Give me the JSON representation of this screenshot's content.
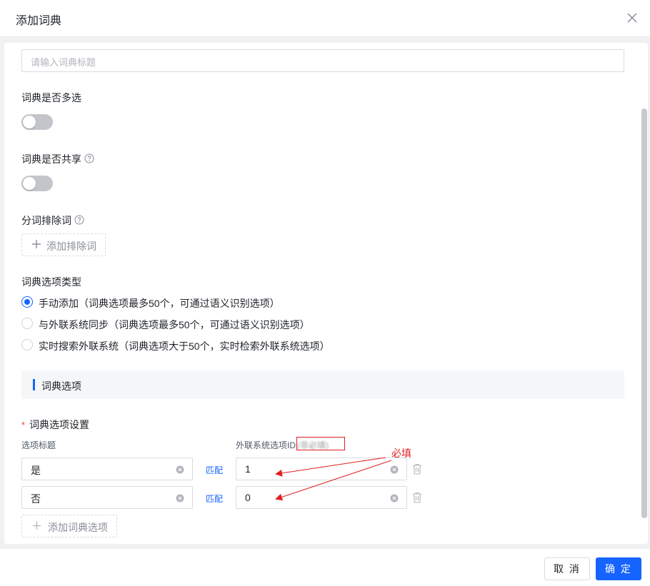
{
  "dialog": {
    "title": "添加词典"
  },
  "form": {
    "title_input": {
      "placeholder": "请输入词典标题",
      "value": ""
    },
    "multi_select": {
      "label": "词典是否多选",
      "on": false
    },
    "shared": {
      "label": "词典是否共享",
      "on": false
    },
    "exclude_words": {
      "label": "分词排除词",
      "add_label": "添加排除词"
    },
    "option_type": {
      "label": "词典选项类型",
      "options": [
        {
          "label": "手动添加（词典选项最多50个，可通过语义识别选项）",
          "checked": true
        },
        {
          "label": "与外联系统同步（词典选项最多50个，可通过语义识别选项）",
          "checked": false
        },
        {
          "label": "实时搜索外联系统（词典选项大于50个，实时检索外联系统选项）",
          "checked": false
        }
      ]
    },
    "section": {
      "title": "词典选项"
    },
    "option_settings": {
      "required_mark": "*",
      "label": "词典选项设置",
      "col_title": "选项标题",
      "col_external_id": "外联系统选项ID",
      "col_external_hint": "(非必填)",
      "match_label": "匹配",
      "rows": [
        {
          "title": "是",
          "external_id": "1"
        },
        {
          "title": "否",
          "external_id": "0"
        }
      ],
      "add_label": "添加词典选项"
    },
    "annotation": {
      "text": "必填"
    }
  },
  "footer": {
    "cancel_label": "取 消",
    "ok_label": "确 定"
  },
  "colors": {
    "primary": "#1664ff",
    "annotation": "#e02020"
  }
}
